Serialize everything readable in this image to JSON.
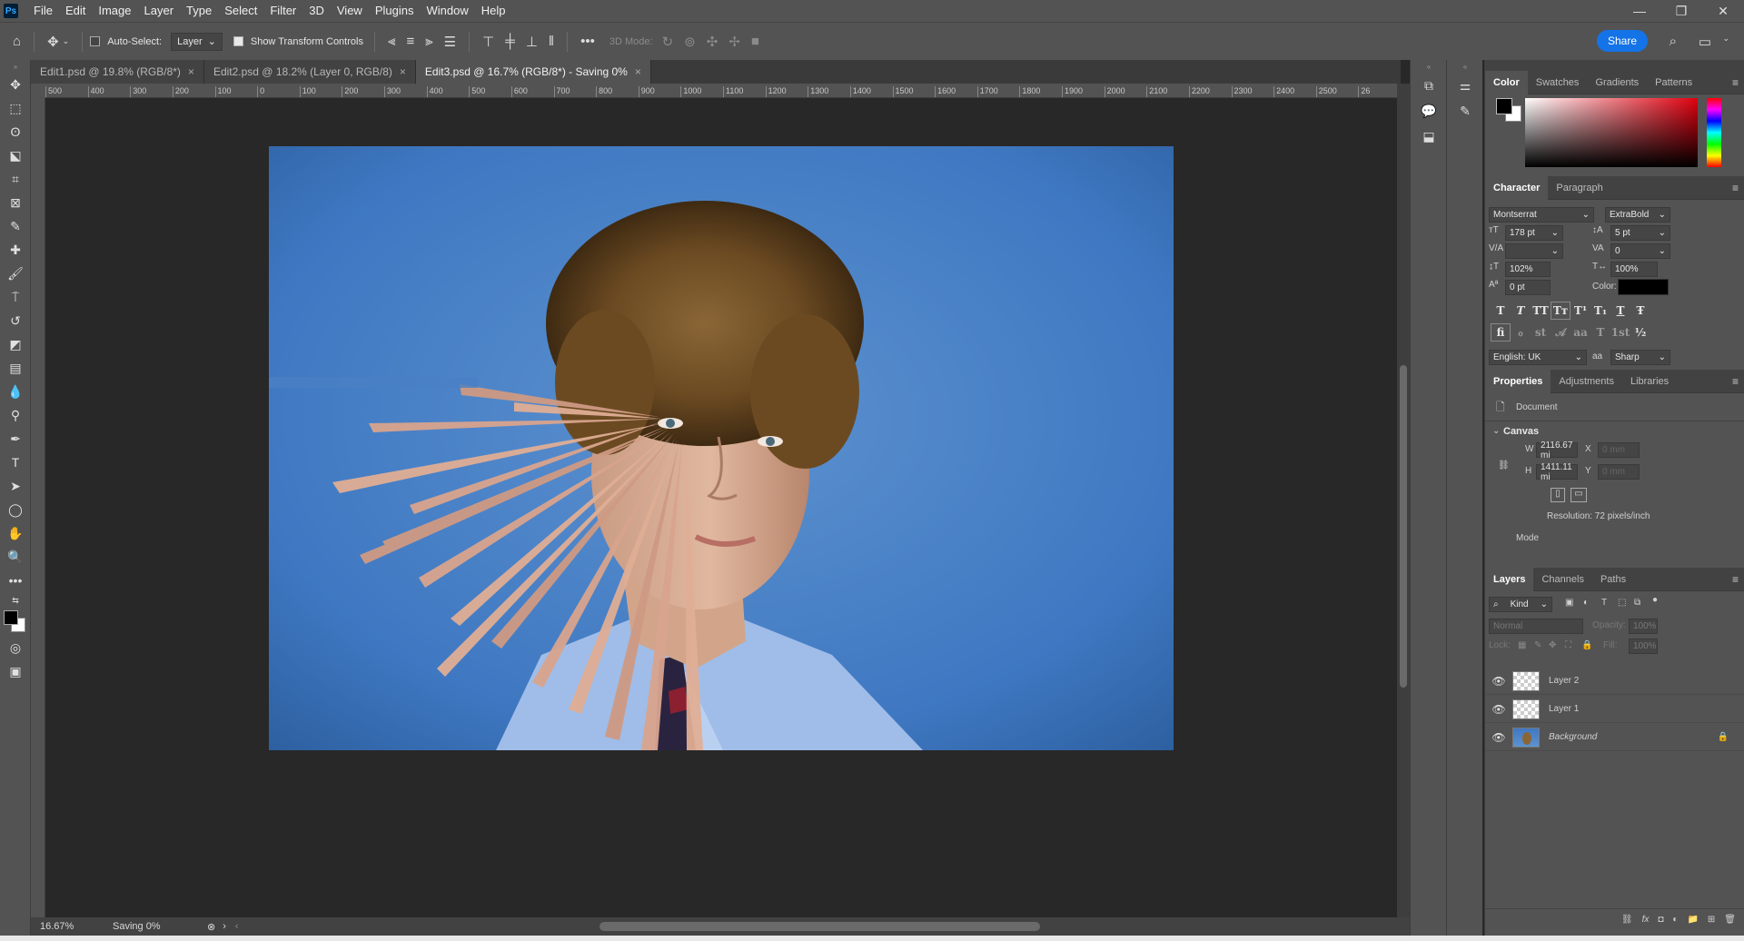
{
  "menu": [
    "File",
    "Edit",
    "Image",
    "Layer",
    "Type",
    "Select",
    "Filter",
    "3D",
    "View",
    "Plugins",
    "Window",
    "Help"
  ],
  "app_logo": "Ps",
  "window_controls": {
    "minimize": "—",
    "maximize": "❐",
    "close": "✕"
  },
  "options_bar": {
    "auto_select_label": "Auto-Select:",
    "auto_select_target": "Layer",
    "show_transform_label": "Show Transform Controls",
    "mode_3d_label": "3D Mode:",
    "share_label": "Share",
    "more_label": "•••"
  },
  "tabs": [
    {
      "label": "Edit1.psd @ 19.8% (RGB/8*)",
      "active": false
    },
    {
      "label": "Edit2.psd @ 18.2% (Layer 0, RGB/8)",
      "active": false
    },
    {
      "label": "Edit3.psd @ 16.7% (RGB/8*) - Saving 0%",
      "active": true
    }
  ],
  "ruler_h_ticks": [
    "500",
    "400",
    "300",
    "200",
    "100",
    "0",
    "100",
    "200",
    "300",
    "400",
    "500",
    "600",
    "700",
    "800",
    "900",
    "1000",
    "1100",
    "1200",
    "1300",
    "1400",
    "1500",
    "1600",
    "1700",
    "1800",
    "1900",
    "2000",
    "2100",
    "2200",
    "2300",
    "2400",
    "2500",
    "26"
  ],
  "status": {
    "zoom": "16.67%",
    "message": "Saving 0%"
  },
  "color_panel": {
    "tabs": [
      "Color",
      "Swatches",
      "Gradients",
      "Patterns"
    ]
  },
  "character_panel": {
    "tabs": [
      "Character",
      "Paragraph"
    ],
    "font_family": "Montserrat",
    "font_style": "ExtraBold",
    "size": "178 pt",
    "leading": "5 pt",
    "kerning": "",
    "tracking": "0",
    "vertical_scale": "102%",
    "horizontal_scale": "100%",
    "baseline_shift": "0 pt",
    "color_label": "Color:",
    "language": "English: UK",
    "antialias": "Sharp",
    "aa_label": "aa",
    "style_glyphs": [
      "T",
      "T",
      "TT",
      "Tт",
      "T¹",
      "T₁",
      "T",
      "Ŧ"
    ],
    "ot_glyphs": [
      "fi",
      "ℴ",
      "st",
      "𝒜",
      "aa",
      "T",
      "1st",
      "½"
    ]
  },
  "properties_panel": {
    "tabs": [
      "Properties",
      "Adjustments",
      "Libraries"
    ],
    "doc_label": "Document",
    "canvas_label": "Canvas",
    "width": "2116.67 mi",
    "height": "1411.11 mi",
    "x_label": "X",
    "y_label": "Y",
    "w_label": "W",
    "h_label": "H",
    "x_placeholder": "0 mm",
    "y_placeholder": "0 mm",
    "resolution": "Resolution: 72 pixels/inch",
    "mode_label": "Mode"
  },
  "layers_panel": {
    "tabs": [
      "Layers",
      "Channels",
      "Paths"
    ],
    "kind_filter": "Kind",
    "blend_mode": "Normal",
    "opacity_label": "Opacity:",
    "opacity": "100%",
    "lock_label": "Lock:",
    "fill_label": "Fill:",
    "fill": "100%",
    "layers": [
      {
        "name": "Layer 2",
        "visible": true,
        "type": "transparent"
      },
      {
        "name": "Layer 1",
        "visible": true,
        "type": "transparent"
      },
      {
        "name": "Background",
        "visible": true,
        "type": "photo",
        "locked": true
      }
    ],
    "bottom_icons": [
      "link-icon",
      "fx-icon",
      "mask-icon",
      "adjustment-icon",
      "folder-icon",
      "new-layer-icon",
      "trash-icon"
    ]
  },
  "colors": {
    "accent": "#1473e6",
    "panel_bg": "#535353",
    "canvas_bg": "#282828",
    "backdrop_blue": "#3f78c2"
  }
}
